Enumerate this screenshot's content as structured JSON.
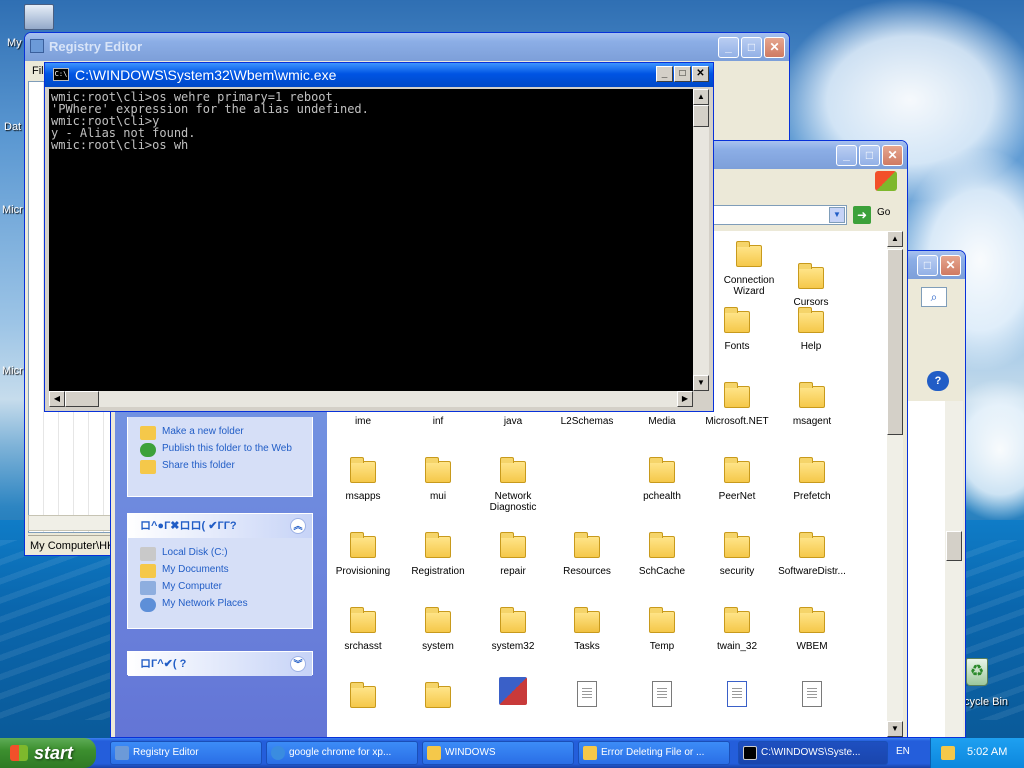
{
  "desktop": {
    "icons": [
      {
        "label": "My"
      },
      {
        "label": "Dat"
      },
      {
        "label": "Micr"
      },
      {
        "label": "Micr"
      },
      {
        "label": "cycle Bin"
      }
    ]
  },
  "registry_editor": {
    "title": "Registry Editor",
    "menu_first": "Fil",
    "status_path": "My Computer\\HK"
  },
  "console": {
    "title": "C:\\WINDOWS\\System32\\Wbem\\wmic.exe",
    "icon_text": "C:\\",
    "lines": [
      "wmic:root\\cli>os wehre primary=1 reboot",
      "'PWhere' expression for the alias undefined.",
      "wmic:root\\cli>y",
      "y - Alias not found.",
      "wmic:root\\cli>os wh"
    ]
  },
  "explorer": {
    "go_label": "Go",
    "file_tasks": [
      {
        "label": "Make a new folder"
      },
      {
        "label": "Publish this folder to the Web"
      },
      {
        "label": "Share this folder"
      }
    ],
    "other_places_header": "ロ^●Г✖ロロ( ✔ГГ?",
    "other_places": [
      {
        "label": "Local Disk (C:)"
      },
      {
        "label": "My Documents"
      },
      {
        "label": "My Computer"
      },
      {
        "label": "My Network Places"
      }
    ],
    "details_header": "ロГ^✔( ?",
    "files": [
      {
        "name": "Connection Wizard",
        "kind": "folder"
      },
      {
        "name": "Cursors",
        "kind": "folder"
      },
      {
        "name": "Fonts",
        "kind": "folder"
      },
      {
        "name": "Help",
        "kind": "folder"
      },
      {
        "name": "ime",
        "kind": "folder"
      },
      {
        "name": "inf",
        "kind": "folder"
      },
      {
        "name": "java",
        "kind": "folder"
      },
      {
        "name": "L2Schemas",
        "kind": "folder"
      },
      {
        "name": "Media",
        "kind": "folder"
      },
      {
        "name": "Microsoft.NET",
        "kind": "folder"
      },
      {
        "name": "msagent",
        "kind": "folder"
      },
      {
        "name": "msapps",
        "kind": "folder"
      },
      {
        "name": "mui",
        "kind": "folder"
      },
      {
        "name": "Network Diagnostic",
        "kind": "folder"
      },
      {
        "name": "pchealth",
        "kind": "folder"
      },
      {
        "name": "PeerNet",
        "kind": "folder"
      },
      {
        "name": "Prefetch",
        "kind": "folder"
      },
      {
        "name": "Provisioning",
        "kind": "folder"
      },
      {
        "name": "Registration",
        "kind": "folder"
      },
      {
        "name": "repair",
        "kind": "folder"
      },
      {
        "name": "Resources",
        "kind": "folder"
      },
      {
        "name": "SchCache",
        "kind": "folder"
      },
      {
        "name": "security",
        "kind": "folder"
      },
      {
        "name": "SoftwareDistr...",
        "kind": "folder"
      },
      {
        "name": "srchasst",
        "kind": "folder"
      },
      {
        "name": "system",
        "kind": "folder"
      },
      {
        "name": "system32",
        "kind": "folder"
      },
      {
        "name": "Tasks",
        "kind": "folder"
      },
      {
        "name": "Temp",
        "kind": "folder"
      },
      {
        "name": "twain_32",
        "kind": "folder"
      },
      {
        "name": "WBEM",
        "kind": "folder"
      }
    ]
  },
  "taskbar": {
    "start_label": "start",
    "tasks": [
      {
        "label": "Registry Editor",
        "active": false
      },
      {
        "label": "google chrome for xp...",
        "active": false
      },
      {
        "label": "WINDOWS",
        "active": false
      },
      {
        "label": "Error Deleting File or ...",
        "active": false
      },
      {
        "label": "C:\\WINDOWS\\Syste...",
        "active": true
      }
    ],
    "language": "EN",
    "clock": "5:02 AM"
  }
}
